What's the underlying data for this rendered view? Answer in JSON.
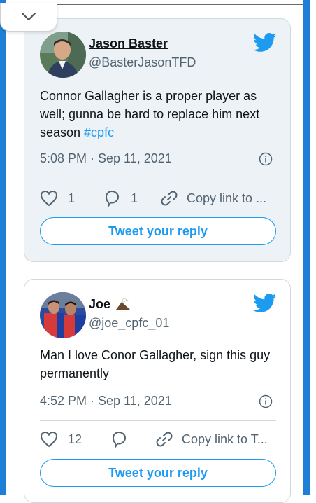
{
  "colors": {
    "accent": "#1d9bf0",
    "frame_blue": "#1d7fd6",
    "text_primary": "#0f1419",
    "text_secondary": "#536471"
  },
  "collapse_toggle": {
    "icon": "chevron-down-icon"
  },
  "tweets": [
    {
      "display_name": "Jason Baster",
      "handle": "@BasterJasonTFD",
      "text": "Connor Gallagher is a proper player as well; gunna be hard to replace him next season ",
      "hashtag": "#cpfc",
      "timestamp": "5:08 PM · Sep 11, 2021",
      "likes": "1",
      "replies": "1",
      "copy_link": "Copy link to ...",
      "reply_button": "Tweet your reply",
      "icons": [
        "twitter-bird-icon",
        "info-icon",
        "heart-icon",
        "reply-bubble-icon",
        "link-icon"
      ]
    },
    {
      "display_name": "Joe",
      "handle": "@joe_cpfc_01",
      "text": "Man I love Conor Gallagher, sign this guy permanently",
      "timestamp": "4:52 PM · Sep 11, 2021",
      "likes": "12",
      "replies": "",
      "copy_link": "Copy link to T...",
      "reply_button": "Tweet your reply",
      "icons": [
        "twitter-bird-icon",
        "eagle-emoji-icon",
        "info-icon",
        "heart-icon",
        "reply-bubble-icon",
        "link-icon"
      ]
    }
  ]
}
